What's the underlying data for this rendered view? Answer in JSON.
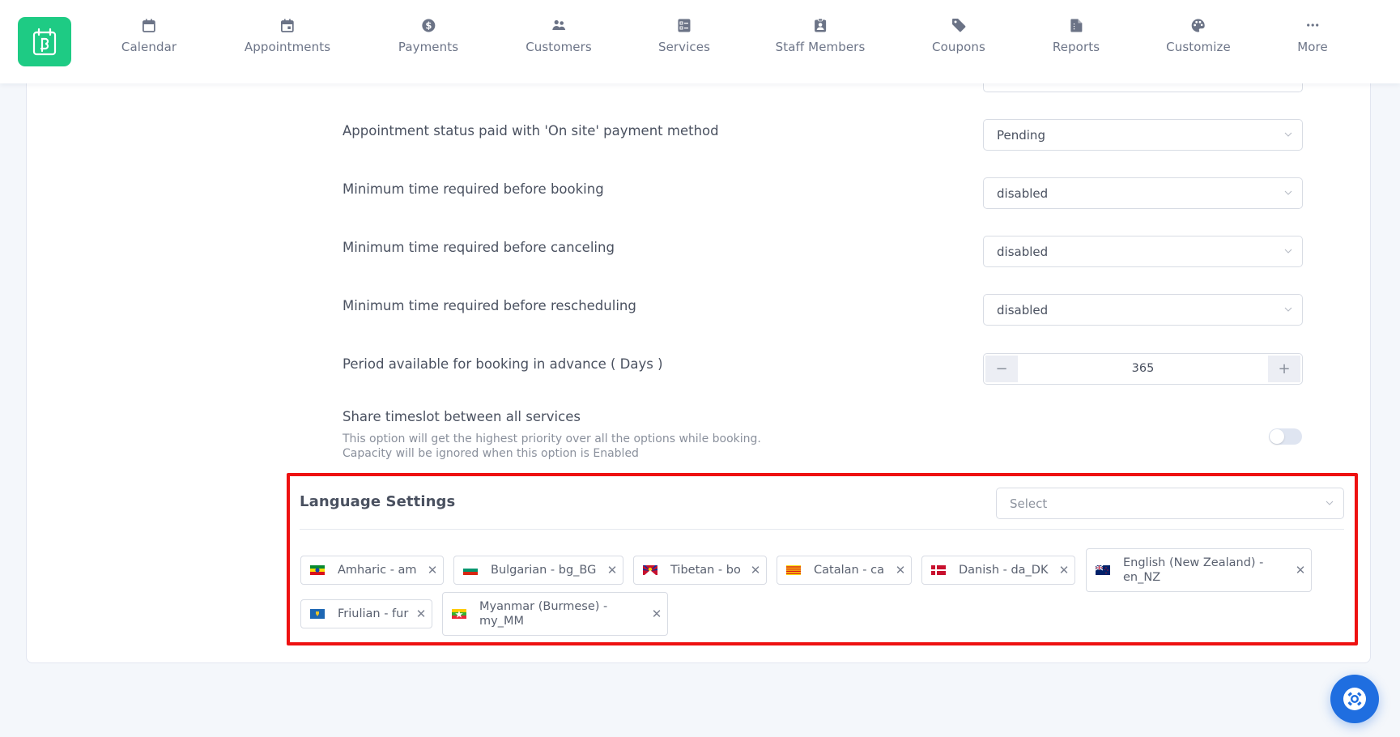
{
  "app": {
    "logo_icon": "bookit-calendar-logo-icon",
    "brand_color": "#1ecb84"
  },
  "nav": {
    "items": [
      {
        "label": "Calendar",
        "icon": "calendar-icon"
      },
      {
        "label": "Appointments",
        "icon": "calendar-event-icon"
      },
      {
        "label": "Payments",
        "icon": "dollar-circle-icon"
      },
      {
        "label": "Customers",
        "icon": "users-icon"
      },
      {
        "label": "Services",
        "icon": "list-icon"
      },
      {
        "label": "Staff Members",
        "icon": "id-badge-icon"
      },
      {
        "label": "Coupons",
        "icon": "tag-icon"
      },
      {
        "label": "Reports",
        "icon": "report-file-icon"
      },
      {
        "label": "Customize",
        "icon": "palette-icon"
      },
      {
        "label": "More",
        "icon": "more-dots-icon"
      }
    ]
  },
  "settings": {
    "rows": [
      {
        "label": "Appointment status paid with 'On site' payment method",
        "value": "Pending"
      },
      {
        "label": "Minimum time required before booking",
        "value": "disabled"
      },
      {
        "label": "Minimum time required before canceling",
        "value": "disabled"
      },
      {
        "label": "Minimum time required before rescheduling",
        "value": "disabled"
      }
    ],
    "advance_period": {
      "label": "Period available for booking in advance ( Days )",
      "value": "365",
      "minus": "−",
      "plus": "+"
    },
    "share_timeslot": {
      "label": "Share timeslot between all services",
      "description_line1": "This option will get the highest priority over all the options while booking.",
      "description_line2": "Capacity will be ignored when this option is Enabled",
      "enabled": false
    }
  },
  "language_settings": {
    "title": "Language Settings",
    "select_placeholder": "Select",
    "remove_symbol": "✕",
    "tags": [
      {
        "label": "Amharic - am",
        "flag": "ethiopia"
      },
      {
        "label": "Bulgarian - bg_BG",
        "flag": "bulgaria"
      },
      {
        "label": "Tibetan - bo",
        "flag": "tibet"
      },
      {
        "label": "Catalan - ca",
        "flag": "catalonia"
      },
      {
        "label": "Danish - da_DK",
        "flag": "denmark"
      },
      {
        "label": "English (New Zealand) - en_NZ",
        "label_line1": "English (New Zealand) -",
        "label_line2": "en_NZ",
        "flag": "new-zealand"
      },
      {
        "label": "Friulian - fur",
        "flag": "friuli"
      },
      {
        "label": "Myanmar (Burmese) - my_MM",
        "label_line1": "Myanmar (Burmese) -",
        "label_line2": "my_MM",
        "flag": "myanmar"
      }
    ]
  },
  "help": {
    "icon": "lifebuoy-icon",
    "color": "#1f6ee0"
  },
  "highlight_color": "#ee1111"
}
